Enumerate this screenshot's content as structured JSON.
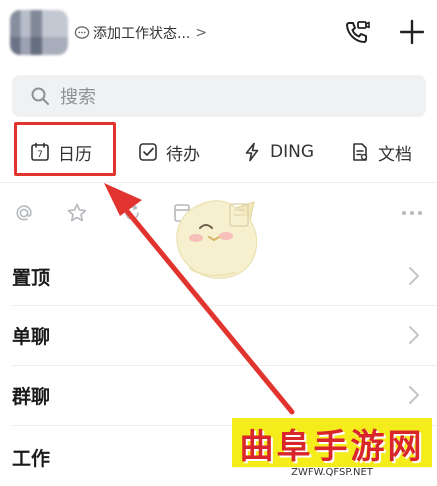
{
  "header": {
    "status_text": "添加工作状态...",
    "status_chevron": ">",
    "call_icon": "video-call-icon",
    "plus_icon": "plus-icon"
  },
  "search": {
    "placeholder": "搜索"
  },
  "tabs": [
    {
      "label": "日历",
      "icon": "calendar-icon",
      "icon_text": "7"
    },
    {
      "label": "待办",
      "icon": "checkbox-icon"
    },
    {
      "label": "DING",
      "icon": "lightning-icon"
    },
    {
      "label": "文档",
      "icon": "document-icon"
    }
  ],
  "filters": [
    "at-icon",
    "star-icon",
    "refresh-icon",
    "archive-icon",
    "more-icon"
  ],
  "sections": [
    {
      "label": "置顶"
    },
    {
      "label": "单聊"
    },
    {
      "label": "群聊"
    },
    {
      "label": "工作"
    }
  ],
  "annotation": {
    "highlight_color": "#e2342e"
  },
  "watermark": {
    "title": "曲阜手游网",
    "url": "ZWFW.QFSP.NET"
  }
}
